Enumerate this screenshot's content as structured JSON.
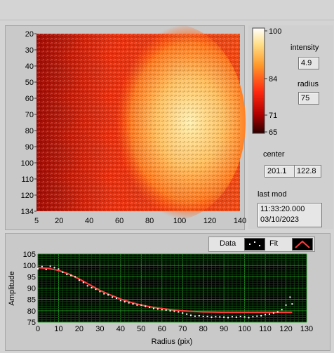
{
  "heatmap": {
    "y_ticks": [
      "20",
      "30",
      "40",
      "50",
      "60",
      "70",
      "80",
      "90",
      "100",
      "110",
      "120",
      "134"
    ],
    "x_ticks": [
      "5",
      "20",
      "40",
      "60",
      "80",
      "100",
      "120",
      "140"
    ]
  },
  "colorbar": {
    "ticks": [
      "100",
      "84",
      "71",
      "65"
    ],
    "colors": [
      "#ffffff",
      "#ffe08a",
      "#ff9a2a",
      "#ff2a10",
      "#b00000",
      "#3a0000"
    ]
  },
  "controls": {
    "intensity_label": "intensity",
    "intensity_value": "4.9",
    "radius_label": "radius",
    "radius_value": "75",
    "center_label": "center",
    "center_x": "201.1⁠",
    "center_y": "122.8",
    "lastmod_label": "last mod",
    "lastmod_time": "11:33:20.000",
    "lastmod_date": "03/10/2023"
  },
  "legend": {
    "data_label": "Data",
    "fit_label": "Fit"
  },
  "chart_data": {
    "type": "scatter",
    "xlabel": "Radius (pix)",
    "ylabel": "Amplitude",
    "xlim": [
      0,
      130
    ],
    "ylim": [
      75,
      105
    ],
    "x_ticks": [
      0,
      10,
      20,
      30,
      40,
      50,
      60,
      70,
      80,
      90,
      100,
      110,
      120,
      130
    ],
    "y_ticks": [
      75,
      80,
      85,
      90,
      95,
      100,
      105
    ],
    "grid": true,
    "series": [
      {
        "name": "Data",
        "color": "#ffffff",
        "x": [
          0,
          2,
          4,
          6,
          8,
          10,
          12,
          14,
          16,
          18,
          20,
          22,
          24,
          26,
          28,
          30,
          32,
          34,
          36,
          38,
          40,
          42,
          44,
          46,
          48,
          50,
          52,
          54,
          56,
          58,
          60,
          62,
          64,
          66,
          68,
          70,
          72,
          74,
          76,
          78,
          80,
          82,
          84,
          86,
          88,
          90,
          92,
          94,
          96,
          98,
          100,
          102,
          104,
          106,
          108,
          110,
          112,
          114,
          116,
          118,
          120,
          122,
          123
        ],
        "y": [
          98.5,
          99.5,
          98.2,
          99.6,
          99.0,
          98.4,
          97.0,
          96.0,
          95.6,
          95.0,
          93.5,
          92.5,
          91.0,
          90.2,
          89.5,
          88.5,
          87.5,
          87.0,
          86.0,
          85.5,
          84.5,
          84.0,
          83.5,
          83.0,
          82.5,
          82.5,
          82.0,
          81.5,
          81.0,
          80.8,
          80.5,
          80.3,
          80.0,
          79.8,
          79.5,
          79.0,
          78.5,
          78.0,
          77.6,
          77.8,
          77.5,
          77.5,
          77.2,
          77.4,
          77.3,
          77.2,
          77.0,
          77.4,
          77.2,
          77.5,
          77.3,
          77.0,
          77.4,
          77.6,
          77.8,
          78.3,
          78.5,
          79.0,
          79.5,
          80.5,
          82.5,
          86.0,
          83.0
        ]
      },
      {
        "name": "Fit",
        "color": "#ff3c3c",
        "x": [
          0,
          5,
          10,
          15,
          20,
          25,
          30,
          35,
          40,
          45,
          50,
          55,
          60,
          65,
          70,
          75,
          80,
          85,
          90,
          95,
          100,
          105,
          110,
          115,
          120,
          123
        ],
        "y": [
          99.0,
          98.7,
          97.8,
          96.2,
          94.0,
          91.5,
          89.0,
          87.0,
          85.2,
          83.7,
          82.5,
          81.6,
          81.0,
          80.4,
          80.0,
          79.7,
          79.5,
          79.4,
          79.3,
          79.3,
          79.3,
          79.3,
          79.3,
          79.3,
          79.3,
          79.3
        ]
      }
    ]
  }
}
